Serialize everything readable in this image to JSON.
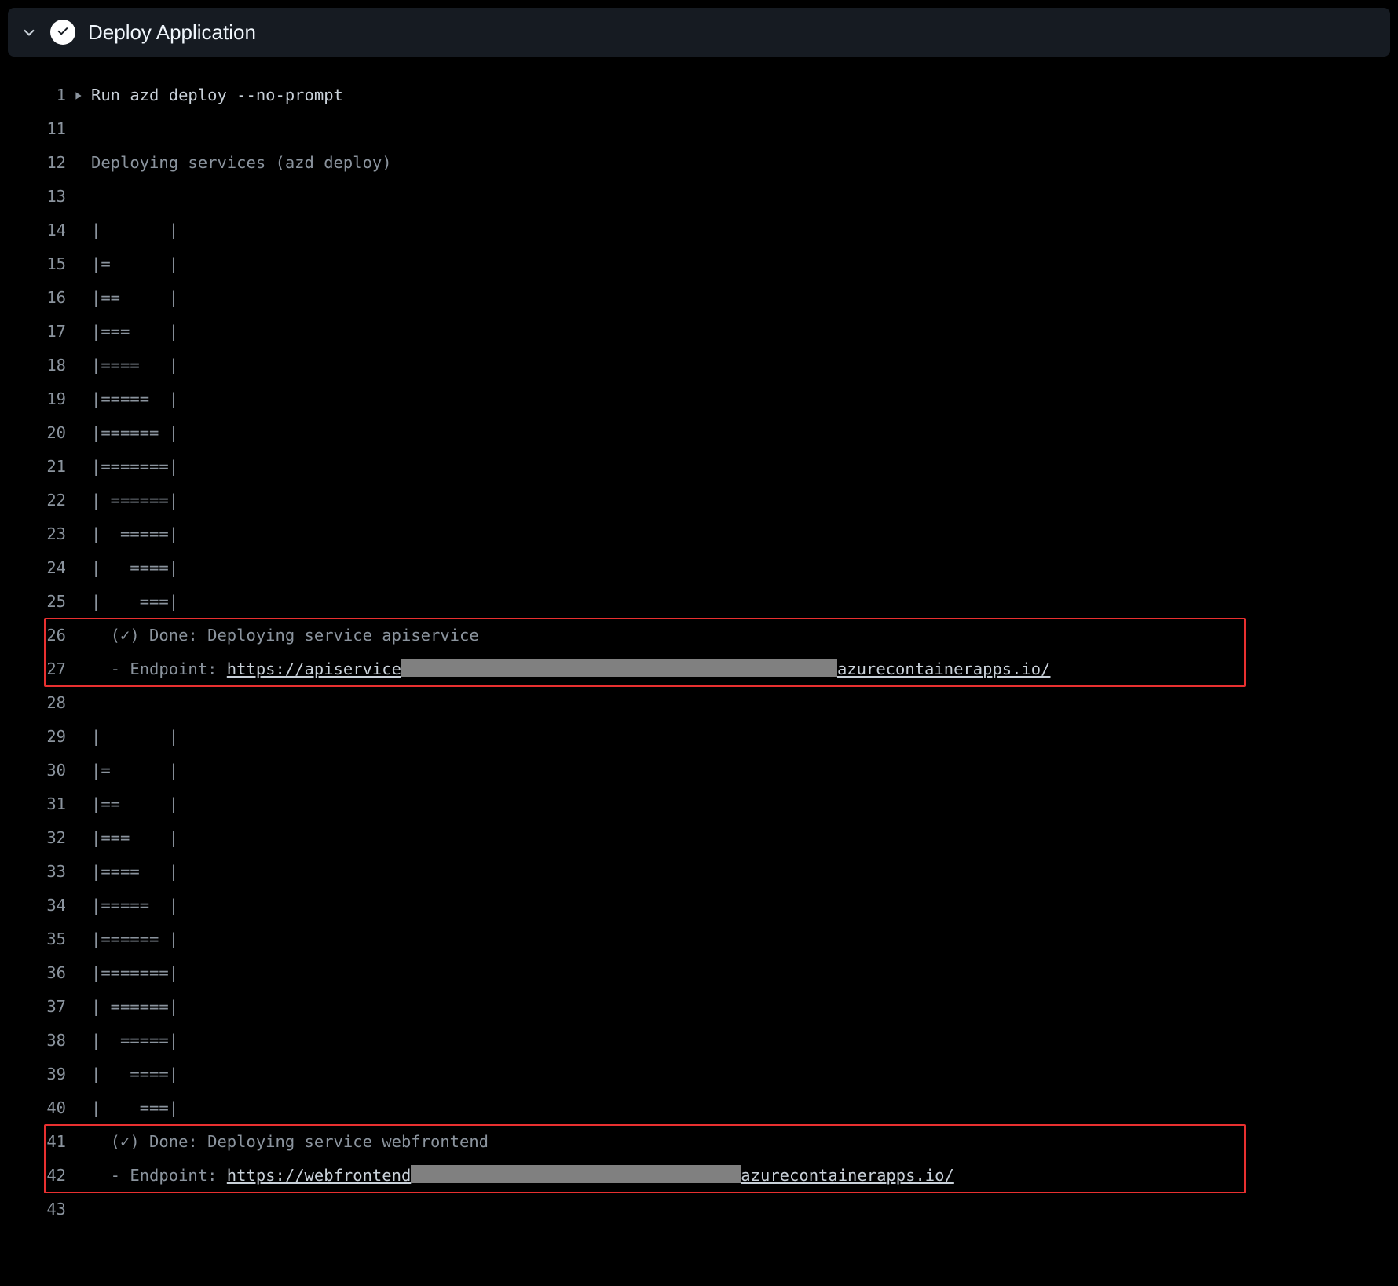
{
  "header": {
    "title": "Deploy Application"
  },
  "log": {
    "cmd_line_no": "1",
    "cmd_text": "Run azd deploy --no-prompt",
    "lines": [
      {
        "no": "11",
        "text": ""
      },
      {
        "no": "12",
        "text": "Deploying services (azd deploy)"
      },
      {
        "no": "13",
        "text": ""
      },
      {
        "no": "14",
        "text": "|       |"
      },
      {
        "no": "15",
        "text": "|=      |"
      },
      {
        "no": "16",
        "text": "|==     |"
      },
      {
        "no": "17",
        "text": "|===    |"
      },
      {
        "no": "18",
        "text": "|====   |"
      },
      {
        "no": "19",
        "text": "|=====  |"
      },
      {
        "no": "20",
        "text": "|====== |"
      },
      {
        "no": "21",
        "text": "|=======|"
      },
      {
        "no": "22",
        "text": "| ======|"
      },
      {
        "no": "23",
        "text": "|  =====|"
      },
      {
        "no": "24",
        "text": "|   ====|"
      },
      {
        "no": "25",
        "text": "|    ===|"
      }
    ],
    "done1_no": "26",
    "done1_text": "  (✓) Done: Deploying service apiservice",
    "ep1_no": "27",
    "ep1_prefix": "  - Endpoint: ",
    "ep1_url_left": "https://apiservice",
    "ep1_url_right": "azurecontainerapps.io/",
    "blank1_no": "28",
    "lines2": [
      {
        "no": "29",
        "text": "|       |"
      },
      {
        "no": "30",
        "text": "|=      |"
      },
      {
        "no": "31",
        "text": "|==     |"
      },
      {
        "no": "32",
        "text": "|===    |"
      },
      {
        "no": "33",
        "text": "|====   |"
      },
      {
        "no": "34",
        "text": "|=====  |"
      },
      {
        "no": "35",
        "text": "|====== |"
      },
      {
        "no": "36",
        "text": "|=======|"
      },
      {
        "no": "37",
        "text": "| ======|"
      },
      {
        "no": "38",
        "text": "|  =====|"
      },
      {
        "no": "39",
        "text": "|   ====|"
      },
      {
        "no": "40",
        "text": "|    ===|"
      }
    ],
    "done2_no": "41",
    "done2_text": "  (✓) Done: Deploying service webfrontend",
    "ep2_no": "42",
    "ep2_prefix": "  - Endpoint: ",
    "ep2_url_left": "https://webfrontend",
    "ep2_url_right": "azurecontainerapps.io/",
    "last_no": "43"
  }
}
